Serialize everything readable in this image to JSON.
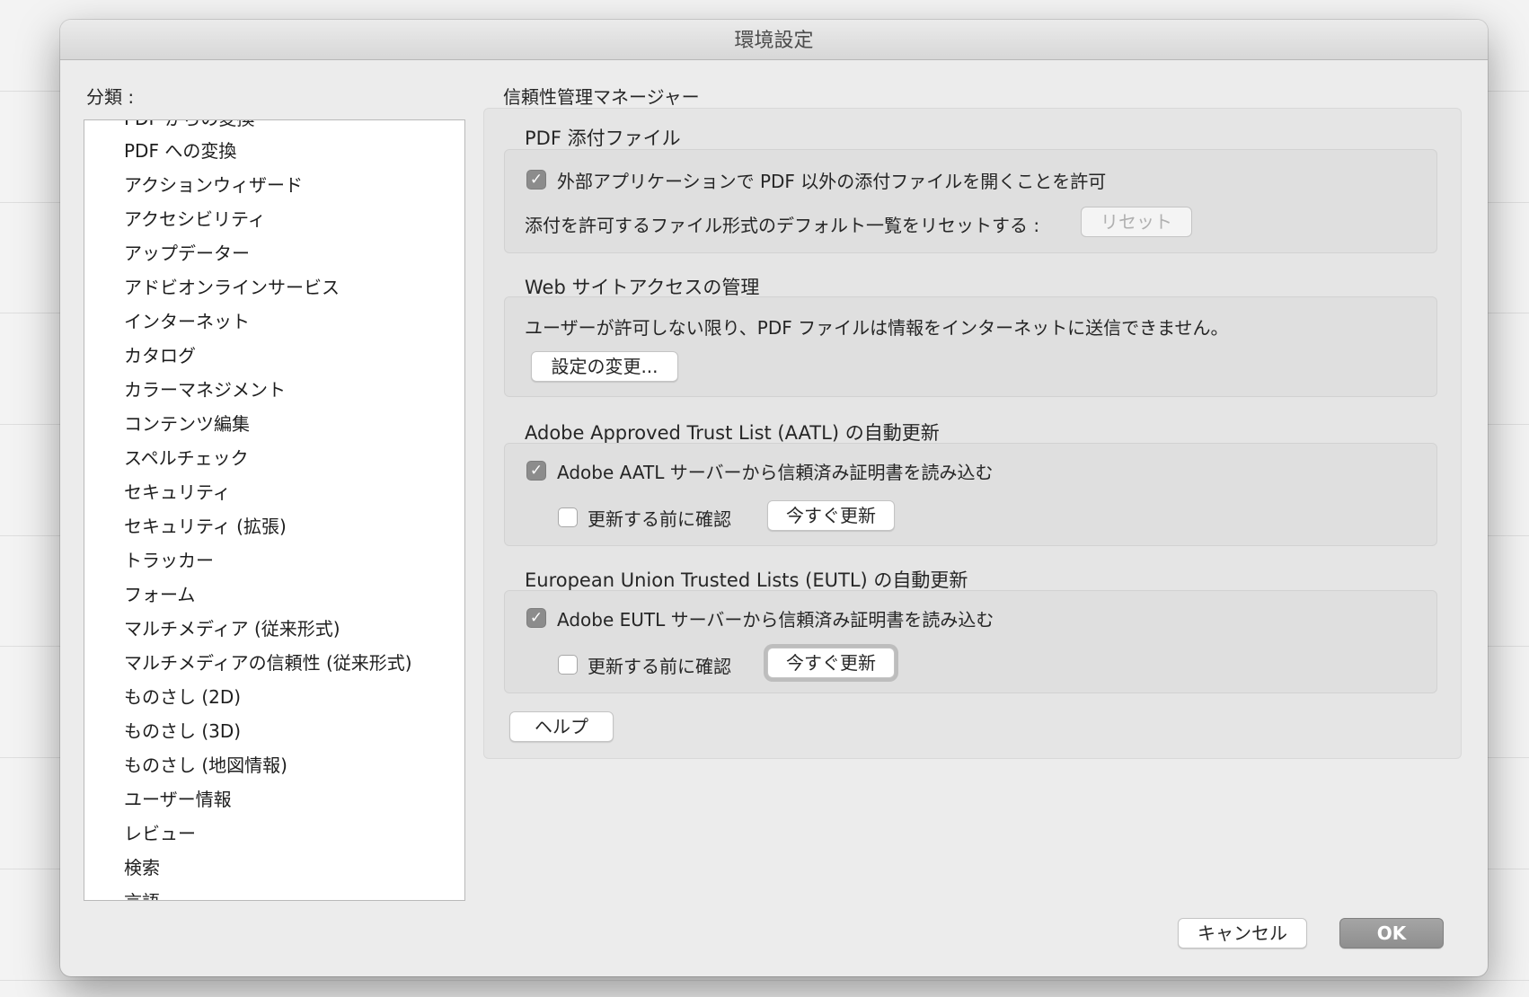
{
  "window": {
    "title": "環境設定"
  },
  "sidebar": {
    "label": "分類 :",
    "items": [
      "PDF からの変換",
      "PDF への変換",
      "アクションウィザード",
      "アクセシビリティ",
      "アップデーター",
      "アドビオンラインサービス",
      "インターネット",
      "カタログ",
      "カラーマネジメント",
      "コンテンツ編集",
      "スペルチェック",
      "セキュリティ",
      "セキュリティ (拡張)",
      "トラッカー",
      "フォーム",
      "マルチメディア (従来形式)",
      "マルチメディアの信頼性 (従来形式)",
      "ものさし (2D)",
      "ものさし (3D)",
      "ものさし (地図情報)",
      "ユーザー情報",
      "レビュー",
      "検索",
      "言語"
    ]
  },
  "panel": {
    "title": "信頼性管理マネージャー",
    "pdf_attachments": {
      "title": "PDF 添付ファイル",
      "allow_label": "外部アプリケーションで PDF 以外の添付ファイルを開くことを許可",
      "allow_checked": true,
      "reset_label": "添付を許可するファイル形式のデフォルト一覧をリセットする :",
      "reset_button": "リセット"
    },
    "web_access": {
      "title": "Web サイトアクセスの管理",
      "description": "ユーザーが許可しない限り、PDF ファイルは情報をインターネットに送信できません。",
      "change_button": "設定の変更..."
    },
    "aatl": {
      "title": "Adobe Approved Trust List (AATL) の自動更新",
      "load_label": "Adobe AATL サーバーから信頼済み証明書を読み込む",
      "load_checked": true,
      "confirm_label": "更新する前に確認",
      "confirm_checked": false,
      "update_button": "今すぐ更新"
    },
    "eutl": {
      "title": "European Union Trusted Lists (EUTL) の自動更新",
      "load_label": "Adobe EUTL サーバーから信頼済み証明書を読み込む",
      "load_checked": true,
      "confirm_label": "更新する前に確認",
      "confirm_checked": false,
      "update_button": "今すぐ更新"
    },
    "help_button": "ヘルプ"
  },
  "footer": {
    "cancel_button": "キャンセル",
    "ok_button": "OK"
  },
  "icons": {
    "checkmark": "checkmark-icon"
  },
  "colors": {
    "checkbox_checked": "#8c8c8c",
    "ok_button": "#939393"
  }
}
